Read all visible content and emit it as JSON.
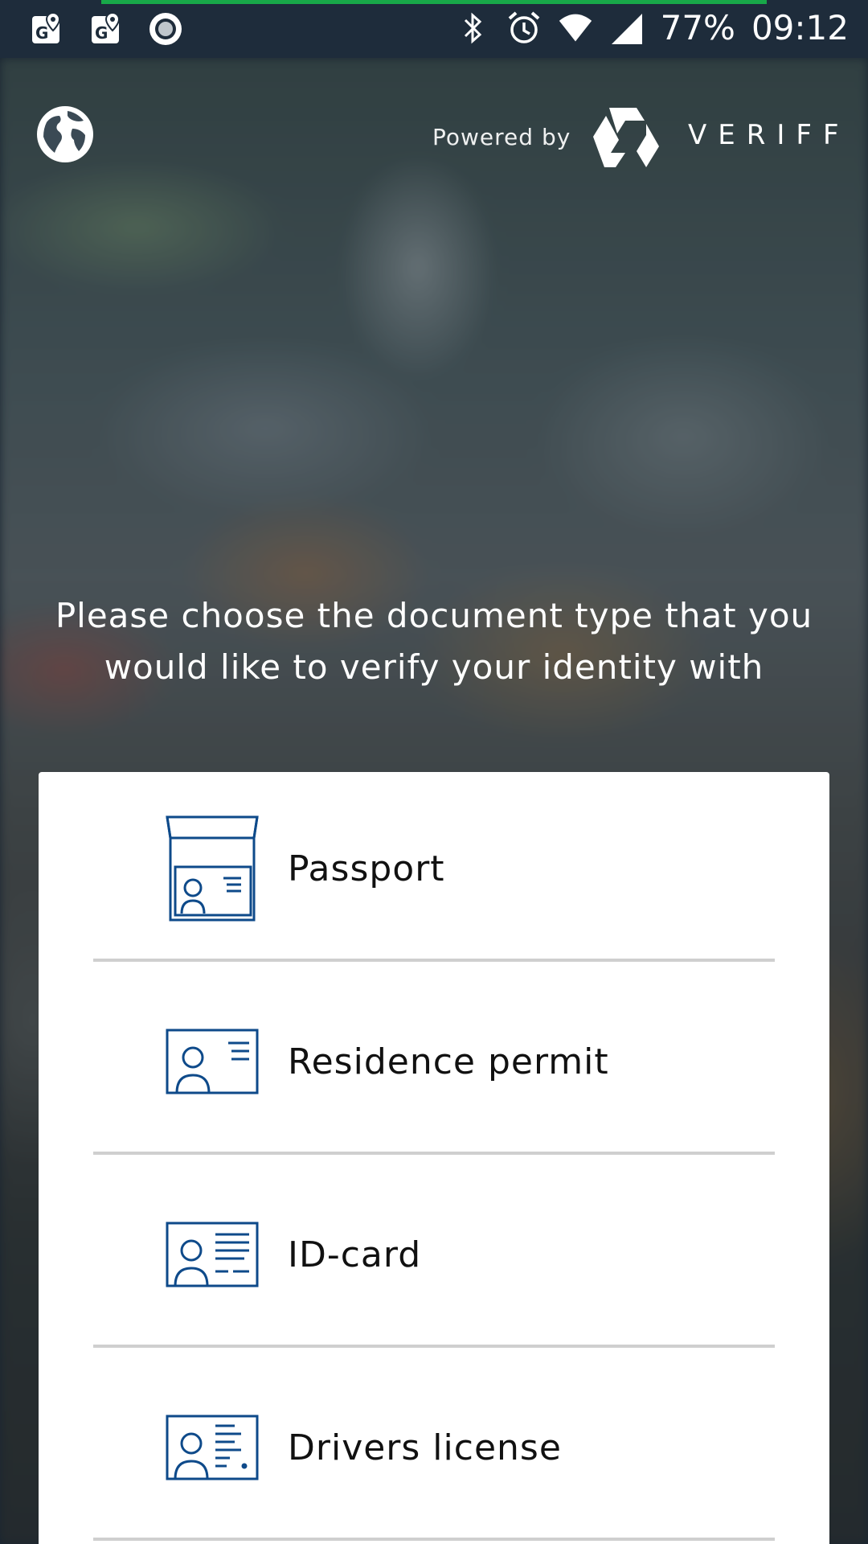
{
  "status_bar": {
    "battery": "77%",
    "time": "09:12",
    "left_icons": [
      "maps-notification-icon",
      "maps-notification-icon",
      "record-icon"
    ],
    "right_icons": [
      "bluetooth-icon",
      "alarm-icon",
      "wifi-icon",
      "signal-icon"
    ]
  },
  "header": {
    "powered_by": "Powered by",
    "brand": "VERIFF",
    "language_icon": "globe-icon"
  },
  "prompt": {
    "line1": "Please choose the document type that you",
    "line2": "would like to verify your identity with"
  },
  "documents": [
    {
      "label": "Passport",
      "icon": "passport-icon"
    },
    {
      "label": "Residence permit",
      "icon": "residence-permit-icon"
    },
    {
      "label": "ID-card",
      "icon": "id-card-icon"
    },
    {
      "label": "Drivers license",
      "icon": "drivers-license-icon"
    }
  ],
  "colors": {
    "status_bar": "#1e2c3b",
    "progress": "#18a849",
    "icon_blue": "#0e4a8a",
    "card": "#ffffff",
    "divider": "#cfcfcf"
  }
}
